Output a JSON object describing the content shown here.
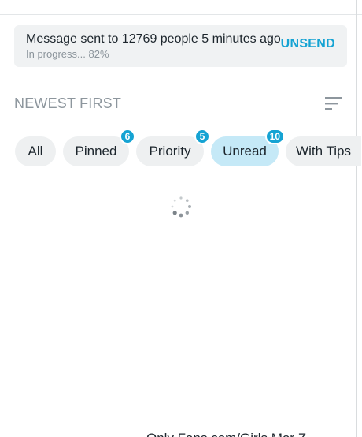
{
  "banner": {
    "message": "Message sent to 12769 people 5 minutes ago",
    "progress": "In progress... 82%",
    "progress_value": 82,
    "action_label": "UNSEND"
  },
  "sort": {
    "label": "NEWEST FIRST",
    "icon": "sort-icon"
  },
  "filters": [
    {
      "label": "All",
      "badge": null,
      "active": false
    },
    {
      "label": "Pinned",
      "badge": "6",
      "active": false
    },
    {
      "label": "Priority",
      "badge": "5",
      "active": false
    },
    {
      "label": "Unread",
      "badge": "10",
      "active": true
    },
    {
      "label": "With Tips",
      "badge": null,
      "active": false
    }
  ],
  "loading_icon": "loading-spinner-icon",
  "bottom_text": "Only Fans.com/Girls Mor Z",
  "colors": {
    "accent": "#15a3d3",
    "chip_active": "#c5e9f7",
    "chip_bg": "#eef0f1",
    "banner_bg": "#f0f2f3"
  }
}
